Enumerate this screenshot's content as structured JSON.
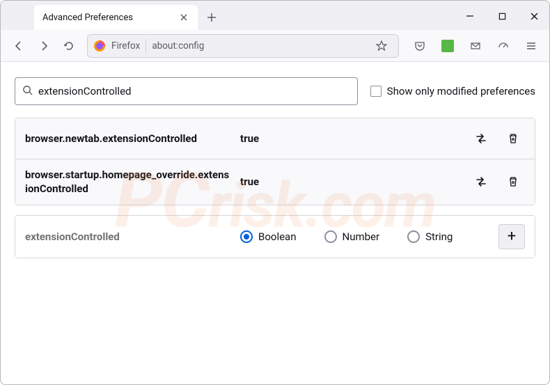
{
  "tab": {
    "title": "Advanced Preferences"
  },
  "urlbar": {
    "brand": "Firefox",
    "url": "about:config"
  },
  "search": {
    "value": "extensionControlled",
    "checkbox_label": "Show only modified preferences"
  },
  "results": [
    {
      "name": "browser.newtab.extensionControlled",
      "value": "true"
    },
    {
      "name": "browser.startup.homepage_override.extensionControlled",
      "value": "true"
    }
  ],
  "new_pref": {
    "name": "extensionControlled",
    "types": [
      {
        "label": "Boolean",
        "checked": true
      },
      {
        "label": "Number",
        "checked": false
      },
      {
        "label": "String",
        "checked": false
      }
    ]
  },
  "watermark": {
    "pc": "PC",
    "rest": "risk.com"
  }
}
